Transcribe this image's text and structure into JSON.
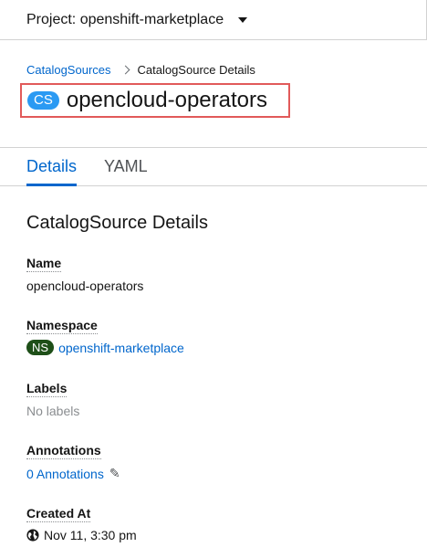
{
  "project_bar": {
    "label": "Project: openshift-marketplace"
  },
  "breadcrumb": {
    "parent": "CatalogSources",
    "current": "CatalogSource Details"
  },
  "header": {
    "badge": "CS",
    "title": "opencloud-operators"
  },
  "tabs": [
    {
      "label": "Details",
      "active": true
    },
    {
      "label": "YAML",
      "active": false
    }
  ],
  "section": {
    "heading": "CatalogSource Details"
  },
  "fields": {
    "name": {
      "label": "Name",
      "value": "opencloud-operators"
    },
    "namespace": {
      "label": "Namespace",
      "badge": "NS",
      "value": "openshift-marketplace"
    },
    "labels": {
      "label": "Labels",
      "value": "No labels"
    },
    "annotations": {
      "label": "Annotations",
      "value": "0 Annotations"
    },
    "created_at": {
      "label": "Created At",
      "value": "Nov 11, 3:30 pm"
    }
  },
  "icons": {
    "caret": "caret-down-icon",
    "breadcrumb_sep": "chevron-right-icon",
    "edit": "pencil-icon",
    "created": "globe-icon"
  },
  "colors": {
    "link": "#0066cc",
    "cs_badge": "#2b9af3",
    "ns_badge": "#1e4f18",
    "highlight_border": "#e15a5a"
  }
}
